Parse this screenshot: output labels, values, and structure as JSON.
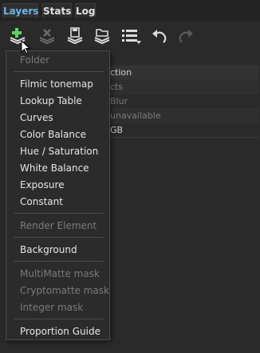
{
  "tabs": [
    {
      "label": "Layers",
      "active": true
    },
    {
      "label": "Stats",
      "active": false
    },
    {
      "label": "Log",
      "active": false
    }
  ],
  "toolbar": {
    "buttons": [
      {
        "icon": "add-layer-icon",
        "enabled": true
      },
      {
        "icon": "delete-layer-icon",
        "enabled": false
      },
      {
        "icon": "save-layer-icon",
        "enabled": true
      },
      {
        "icon": "open-layer-icon",
        "enabled": true
      },
      {
        "icon": "list-options-icon",
        "enabled": true
      },
      {
        "icon": "undo-icon",
        "enabled": true
      },
      {
        "icon": "redo-icon",
        "enabled": false
      }
    ]
  },
  "background_rows": [
    {
      "text": "ction",
      "style": "hdr"
    },
    {
      "text": "cts",
      "style": "dim"
    },
    {
      "text": "Blur",
      "style": "dim"
    },
    {
      "text": "unavailable",
      "style": "dim"
    },
    {
      "text": "GB",
      "style": "norm"
    }
  ],
  "menu": {
    "items": [
      {
        "label": "Folder",
        "enabled": false
      },
      {
        "label": "Filmic tonemap",
        "enabled": true
      },
      {
        "label": "Lookup Table",
        "enabled": true
      },
      {
        "label": "Curves",
        "enabled": true
      },
      {
        "label": "Color Balance",
        "enabled": true
      },
      {
        "label": "Hue / Saturation",
        "enabled": true
      },
      {
        "label": "White Balance",
        "enabled": true
      },
      {
        "label": "Exposure",
        "enabled": true
      },
      {
        "label": "Constant",
        "enabled": true
      },
      {
        "label": "Render Element",
        "enabled": false
      },
      {
        "label": "Background",
        "enabled": true
      },
      {
        "label": "MultiMatte mask",
        "enabled": false
      },
      {
        "label": "Cryptomatte mask",
        "enabled": false
      },
      {
        "label": "Integer mask",
        "enabled": false
      },
      {
        "label": "Proportion Guide",
        "enabled": true
      }
    ]
  },
  "colors": {
    "active_tab": "#6fb3e8",
    "add_icon": "#5fd35f"
  }
}
